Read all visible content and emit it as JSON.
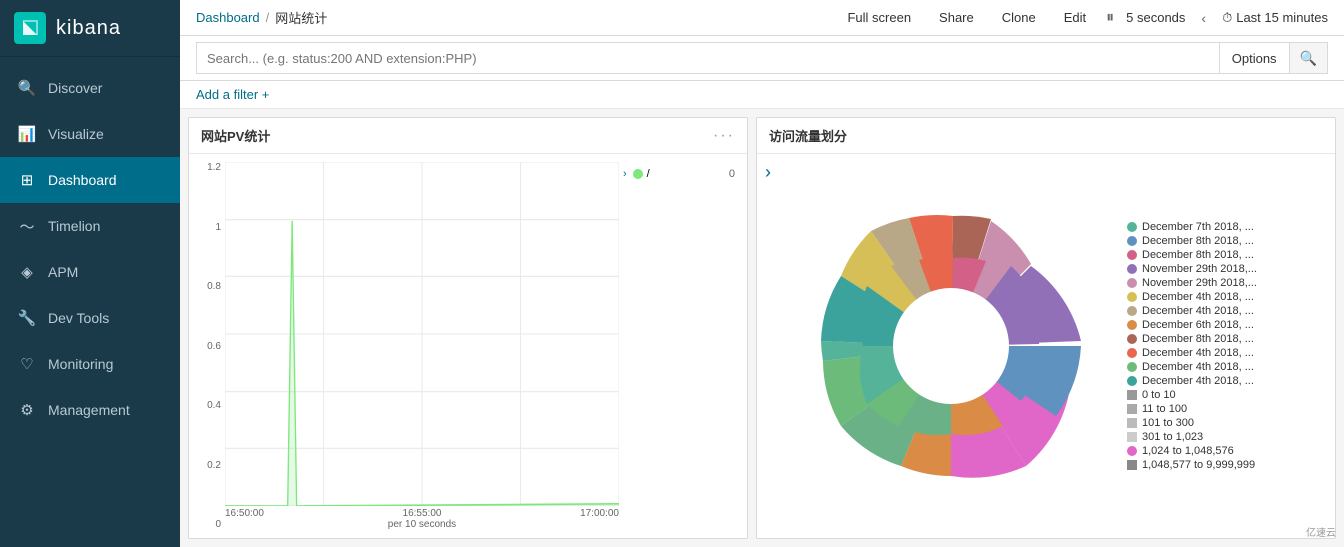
{
  "app": {
    "logo_letter": "k",
    "logo_text": "kibana"
  },
  "sidebar": {
    "items": [
      {
        "id": "discover",
        "label": "Discover",
        "icon": "🔍",
        "active": false
      },
      {
        "id": "visualize",
        "label": "Visualize",
        "icon": "📊",
        "active": false
      },
      {
        "id": "dashboard",
        "label": "Dashboard",
        "icon": "🗂",
        "active": true
      },
      {
        "id": "timelion",
        "label": "Timelion",
        "icon": "⏱",
        "active": false
      },
      {
        "id": "apm",
        "label": "APM",
        "icon": "◈",
        "active": false
      },
      {
        "id": "devtools",
        "label": "Dev Tools",
        "icon": "🔧",
        "active": false
      },
      {
        "id": "monitoring",
        "label": "Monitoring",
        "icon": "♡",
        "active": false
      },
      {
        "id": "management",
        "label": "Management",
        "icon": "⚙",
        "active": false
      }
    ]
  },
  "topbar": {
    "breadcrumb_link": "Dashboard",
    "breadcrumb_separator": "/",
    "breadcrumb_current": "网站统计",
    "btn_fullscreen": "Full screen",
    "btn_share": "Share",
    "btn_clone": "Clone",
    "btn_edit": "Edit",
    "refresh_interval": "5 seconds",
    "time_picker_label": "Last 15 minutes"
  },
  "searchbar": {
    "placeholder": "Search... (e.g. status:200 AND extension:PHP)",
    "options_label": "Options",
    "search_icon": "🔍"
  },
  "filterbar": {
    "add_filter_label": "Add a filter +"
  },
  "panels": {
    "left": {
      "title": "网站PV统计",
      "menu_icon": "···",
      "y_axis_labels": [
        "1.2",
        "1",
        "0.8",
        "0.6",
        "0.4",
        "0.2",
        "0"
      ],
      "x_axis_labels": [
        "16:50:00",
        "16:55:00",
        "17:00:00"
      ],
      "x_sublabel": "per 10 seconds",
      "legend_items": [
        {
          "color": "#7de87d",
          "label": "/",
          "value": "0"
        }
      ]
    },
    "right": {
      "title": "访问流量划分",
      "legend_items": [
        {
          "color": "#54b399",
          "label": "December 7th 2018, ..."
        },
        {
          "color": "#6092c0",
          "label": "December 8th 2018, ..."
        },
        {
          "color": "#d36086",
          "label": "December 8th 2018, ..."
        },
        {
          "color": "#9170b8",
          "label": "November 29th 2018,..."
        },
        {
          "color": "#ca8eae",
          "label": "November 29th 2018,..."
        },
        {
          "color": "#d6bf57",
          "label": "December 4th 2018, ..."
        },
        {
          "color": "#b9a888",
          "label": "December 4th 2018, ..."
        },
        {
          "color": "#da8b45",
          "label": "December 6th 2018, ..."
        },
        {
          "color": "#aa6556",
          "label": "December 8th 2018, ..."
        },
        {
          "color": "#e7664c",
          "label": "December 4th 2018, ..."
        },
        {
          "color": "#6dbb7a",
          "label": "December 4th 2018, ..."
        },
        {
          "color": "#3ba39c",
          "label": "December 4th 2018, ..."
        },
        {
          "color": "#999999",
          "label": "0 to 10"
        },
        {
          "color": "#aaaaaa",
          "label": "11 to 100"
        },
        {
          "color": "#bbbbbb",
          "label": "101 to 300"
        },
        {
          "color": "#cccccc",
          "label": "301 to 1,023"
        },
        {
          "color": "#e066c7",
          "label": "1,024 to 1,048,576"
        },
        {
          "color": "#888888",
          "label": "1,048,577 to 9,999,999"
        }
      ],
      "donut_segments": [
        {
          "color": "#6ab187",
          "startAngle": 0,
          "endAngle": 25
        },
        {
          "color": "#54b399",
          "startAngle": 25,
          "endAngle": 55
        },
        {
          "color": "#3ba39c",
          "startAngle": 55,
          "endAngle": 85
        },
        {
          "color": "#6dbb7a",
          "startAngle": 85,
          "endAngle": 115
        },
        {
          "color": "#b9a888",
          "startAngle": 115,
          "endAngle": 130
        },
        {
          "color": "#d6bf57",
          "startAngle": 130,
          "endAngle": 145
        },
        {
          "color": "#aa6556",
          "startAngle": 145,
          "endAngle": 160
        },
        {
          "color": "#e7664c",
          "startAngle": 160,
          "endAngle": 180
        },
        {
          "color": "#d36086",
          "startAngle": 180,
          "endAngle": 200
        },
        {
          "color": "#6092c0",
          "startAngle": 200,
          "endAngle": 230
        },
        {
          "color": "#9170b8",
          "startAngle": 230,
          "endAngle": 260
        },
        {
          "color": "#ca8eae",
          "startAngle": 260,
          "endAngle": 280
        },
        {
          "color": "#da8b45",
          "startAngle": 280,
          "endAngle": 300
        },
        {
          "color": "#e066c7",
          "startAngle": 300,
          "endAngle": 360
        }
      ]
    }
  },
  "watermark": "亿速云"
}
